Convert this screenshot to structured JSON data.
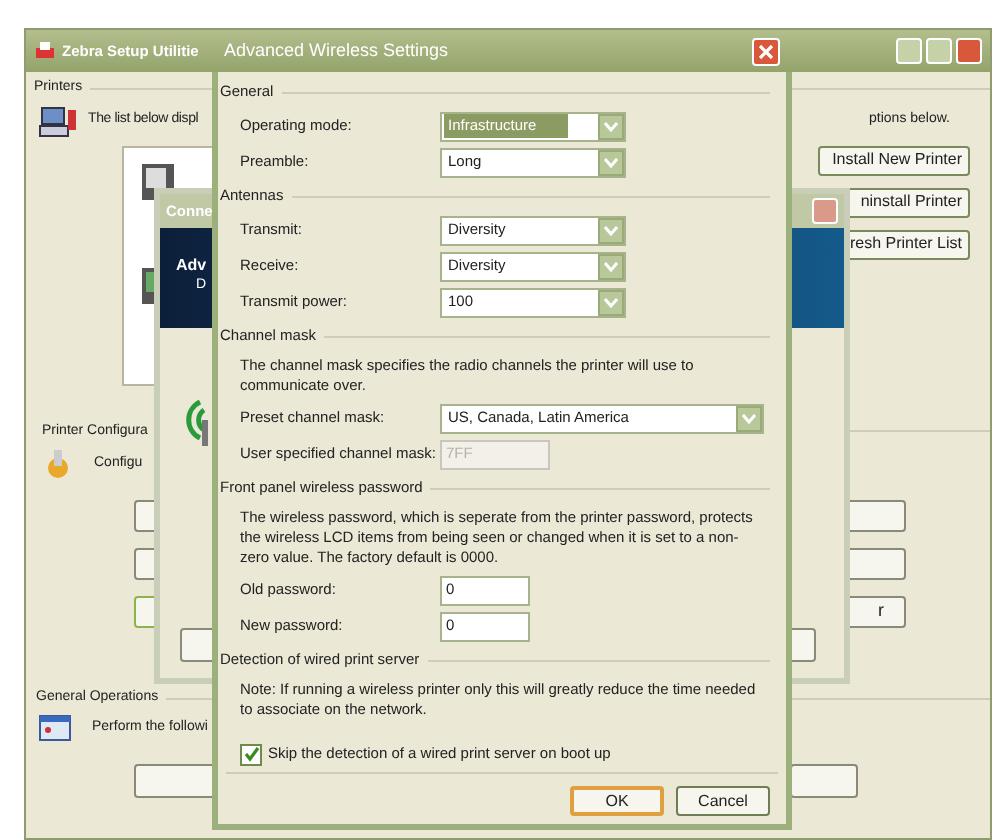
{
  "main_window": {
    "title": "Zebra Setup Utilitie",
    "printers_group": {
      "label": "Printers",
      "description_start": "The list below displ",
      "description_end": "ptions below."
    },
    "printer_buttons": [
      {
        "label": "Install New Printer"
      },
      {
        "label": "ninstall Printer"
      },
      {
        "label": "resh Printer List"
      }
    ],
    "configuration_group": {
      "label": "Printer Configura",
      "description": "Configu",
      "last_right_button_label": "r"
    },
    "operations_group": {
      "label": "General Operations",
      "description": "Perform the followi"
    }
  },
  "connection_dialog": {
    "title": "Conne",
    "banner_title": "Adv",
    "banner_subtitle": "D"
  },
  "dialog": {
    "title": "Advanced Wireless Settings",
    "sections": [
      {
        "label": "General",
        "items": [
          {
            "kind": "select",
            "label": "Operating mode:",
            "value": "Infrastructure",
            "focused": true
          },
          {
            "kind": "select",
            "label": "Preamble:",
            "value": "Long",
            "focused": false
          }
        ]
      },
      {
        "label": "Antennas",
        "items": [
          {
            "kind": "select",
            "label": "Transmit:",
            "value": "Diversity",
            "focused": false
          },
          {
            "kind": "select",
            "label": "Receive:",
            "value": "Diversity",
            "focused": false
          },
          {
            "kind": "select",
            "label": "Transmit power:",
            "value": "100",
            "focused": false
          }
        ]
      },
      {
        "label": "Channel mask",
        "items": [
          {
            "kind": "note",
            "text": "The channel mask specifies the radio channels the printer will use to communicate over."
          },
          {
            "kind": "wide-select",
            "label": "Preset channel mask:",
            "value": "US, Canada, Latin America",
            "focused": false
          },
          {
            "kind": "input",
            "label": "User specified channel mask:",
            "value": "7FF",
            "disabled": true
          }
        ]
      },
      {
        "label": "Front panel wireless password",
        "items": [
          {
            "kind": "note",
            "text": "The wireless password, which is seperate from the printer password, protects the wireless LCD items from being seen or changed when it is set to a non-zero value. The factory default is 0000."
          },
          {
            "kind": "input",
            "label": "Old password:",
            "value": "0",
            "disabled": false
          },
          {
            "kind": "input",
            "label": "New password:",
            "value": "0",
            "disabled": false
          }
        ]
      },
      {
        "label": "Detection of wired print server",
        "items": [
          {
            "kind": "note",
            "text": "Note: If running a wireless printer only this will greatly reduce the time needed to associate on the network."
          },
          {
            "kind": "checkbox",
            "label": "Skip the detection of a wired print server on boot up",
            "checked": true
          }
        ]
      }
    ],
    "buttons": [
      {
        "label": "OK",
        "default": true
      },
      {
        "label": "Cancel",
        "default": false
      }
    ]
  }
}
